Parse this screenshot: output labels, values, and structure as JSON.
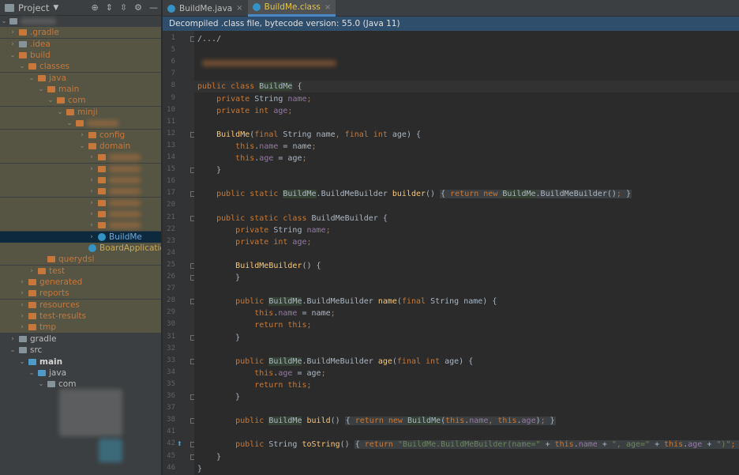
{
  "project_panel": {
    "title": "Project",
    "dropdown_icon": "triangle-down-icon",
    "toolbar_icons": [
      "crosshair-icon",
      "expand-all-icon",
      "collapse-all-icon",
      "gear-icon",
      "minimize-icon"
    ],
    "tree": [
      {
        "label": ".gradle",
        "depth": 1,
        "expanded": false,
        "icon": "folder-orange",
        "color": "orange",
        "hl": true
      },
      {
        "label": ".idea",
        "depth": 1,
        "expanded": false,
        "icon": "folder-gray",
        "color": "orange",
        "hl": true
      },
      {
        "label": "build",
        "depth": 1,
        "expanded": true,
        "icon": "folder-orange",
        "color": "orange",
        "hl": true
      },
      {
        "label": "classes",
        "depth": 2,
        "expanded": true,
        "icon": "folder-orange",
        "color": "orange",
        "hl": true
      },
      {
        "label": "java",
        "depth": 3,
        "expanded": true,
        "icon": "folder-orange",
        "color": "orange",
        "hl": true
      },
      {
        "label": "main",
        "depth": 4,
        "expanded": true,
        "icon": "folder-orange",
        "color": "orange",
        "hl": true
      },
      {
        "label": "com",
        "depth": 5,
        "expanded": true,
        "icon": "folder-orange",
        "color": "orange",
        "hl": true
      },
      {
        "label": "minji",
        "depth": 6,
        "expanded": true,
        "icon": "folder-orange",
        "color": "orange",
        "hl": true
      },
      {
        "label": "",
        "depth": 7,
        "expanded": true,
        "icon": "folder-orange",
        "color": "orange",
        "hl": true,
        "blurred": true
      },
      {
        "label": "config",
        "depth": 8,
        "expanded": false,
        "icon": "folder-orange",
        "color": "orange",
        "hl": true
      },
      {
        "label": "domain",
        "depth": 8,
        "expanded": true,
        "icon": "folder-orange",
        "color": "orange",
        "hl": true
      },
      {
        "label": "",
        "depth": 9,
        "expanded": false,
        "icon": "folder-orange",
        "color": "orange",
        "hl": true,
        "blurred": true
      },
      {
        "label": "",
        "depth": 9,
        "expanded": false,
        "icon": "folder-orange",
        "color": "orange",
        "hl": true,
        "blurred": true
      },
      {
        "label": "",
        "depth": 9,
        "expanded": false,
        "icon": "folder-orange",
        "color": "orange",
        "hl": true,
        "blurred": true
      },
      {
        "label": "",
        "depth": 9,
        "expanded": false,
        "icon": "folder-orange",
        "color": "orange",
        "hl": true,
        "blurred": true
      },
      {
        "label": "",
        "depth": 9,
        "expanded": false,
        "icon": "folder-orange",
        "color": "orange",
        "hl": true,
        "blurred": true
      },
      {
        "label": "",
        "depth": 9,
        "expanded": false,
        "icon": "folder-orange",
        "color": "orange",
        "hl": true,
        "blurred": true
      },
      {
        "label": "",
        "depth": 9,
        "expanded": false,
        "icon": "folder-orange",
        "color": "orange",
        "hl": true,
        "blurred": true
      },
      {
        "label": "BuildMe",
        "depth": 9,
        "expanded": false,
        "icon": "class-file",
        "color": "blue",
        "sel": true
      },
      {
        "label": "BoardApplication",
        "depth": 8,
        "leaf": true,
        "icon": "class-file",
        "color": "yellow",
        "hl": true
      },
      {
        "label": "querydsl",
        "depth": 4,
        "leaf": true,
        "icon": "folder-orange",
        "color": "orange",
        "hl": true
      },
      {
        "label": "test",
        "depth": 3,
        "expanded": false,
        "icon": "folder-orange",
        "color": "orange",
        "hl": true
      },
      {
        "label": "generated",
        "depth": 2,
        "expanded": false,
        "icon": "folder-orange",
        "color": "orange",
        "hl": true
      },
      {
        "label": "reports",
        "depth": 2,
        "expanded": false,
        "icon": "folder-orange",
        "color": "orange",
        "hl": true
      },
      {
        "label": "resources",
        "depth": 2,
        "expanded": false,
        "icon": "folder-orange",
        "color": "orange",
        "hl": true
      },
      {
        "label": "test-results",
        "depth": 2,
        "expanded": false,
        "icon": "folder-orange",
        "color": "orange",
        "hl": true
      },
      {
        "label": "tmp",
        "depth": 2,
        "expanded": false,
        "icon": "folder-orange",
        "color": "orange",
        "hl": true
      },
      {
        "label": "gradle",
        "depth": 1,
        "expanded": false,
        "icon": "folder-gray",
        "color": "white"
      },
      {
        "label": "src",
        "depth": 1,
        "expanded": true,
        "icon": "folder-gray",
        "color": "white"
      },
      {
        "label": "main",
        "depth": 2,
        "expanded": true,
        "icon": "folder-blue",
        "color": "bold"
      },
      {
        "label": "java",
        "depth": 3,
        "expanded": true,
        "icon": "folder-blue",
        "color": "white"
      },
      {
        "label": "com",
        "depth": 4,
        "expanded": true,
        "icon": "folder-gray",
        "color": "white"
      }
    ]
  },
  "editor": {
    "tabs": [
      {
        "label": "BuildMe.java",
        "active": false
      },
      {
        "label": "BuildMe.class",
        "active": true
      }
    ],
    "banner": "Decompiled .class file, bytecode version: 55.0 (Java 11)",
    "lines": [
      {
        "n": "1",
        "html": "/.../",
        "fold": true
      },
      {
        "n": "5",
        "html": ""
      },
      {
        "n": "6",
        "html": "",
        "blurred": true
      },
      {
        "n": "7",
        "html": ""
      },
      {
        "n": "8",
        "html": "<span class=\"kw\">public class </span><span class=\"hlid\">BuildMe</span> {",
        "current": true
      },
      {
        "n": "9",
        "html": "    <span class=\"kw\">private </span>String <span class=\"fld\">name</span><span class=\"kw\">;</span>"
      },
      {
        "n": "10",
        "html": "    <span class=\"kw\">private int </span><span class=\"fld\">age</span><span class=\"kw\">;</span>"
      },
      {
        "n": "11",
        "html": ""
      },
      {
        "n": "12",
        "html": "    <span class=\"fn\">BuildMe</span>(<span class=\"kw\">final </span>String name<span class=\"kw\">, final int </span>age) {",
        "fold": true
      },
      {
        "n": "13",
        "html": "        <span class=\"kw\">this</span>.<span class=\"fld\">name</span> = name<span class=\"kw\">;</span>"
      },
      {
        "n": "14",
        "html": "        <span class=\"kw\">this</span>.<span class=\"fld\">age</span> = age<span class=\"kw\">;</span>"
      },
      {
        "n": "15",
        "html": "    }",
        "fold": true
      },
      {
        "n": "16",
        "html": ""
      },
      {
        "n": "17",
        "html": "    <span class=\"kw\">public static </span><span class=\"hlid\">BuildMe</span>.BuildMeBuilder <span class=\"fn\">builder</span>() <span class=\"fold\">{ <span class=\"kw\">return new </span><span class=\"hlid\">BuildMe</span>.BuildMeBuilder()<span class=\"kw\">;</span> }</span>",
        "fold": true
      },
      {
        "n": "20",
        "html": ""
      },
      {
        "n": "21",
        "html": "    <span class=\"kw\">public static class </span>BuildMeBuilder {",
        "fold": true
      },
      {
        "n": "22",
        "html": "        <span class=\"kw\">private </span>String <span class=\"fld\">name</span><span class=\"kw\">;</span>"
      },
      {
        "n": "23",
        "html": "        <span class=\"kw\">private int </span><span class=\"fld\">age</span><span class=\"kw\">;</span>"
      },
      {
        "n": "24",
        "html": ""
      },
      {
        "n": "25",
        "html": "        <span class=\"fn\">BuildMeBuilder</span>() {",
        "fold": true
      },
      {
        "n": "26",
        "html": "        }",
        "fold": true
      },
      {
        "n": "27",
        "html": ""
      },
      {
        "n": "28",
        "html": "        <span class=\"kw\">public </span><span class=\"hlid\">BuildMe</span>.BuildMeBuilder <span class=\"fn\">name</span>(<span class=\"kw\">final </span>String name) {",
        "fold": true
      },
      {
        "n": "29",
        "html": "            <span class=\"kw\">this</span>.<span class=\"fld\">name</span> = name<span class=\"kw\">;</span>"
      },
      {
        "n": "30",
        "html": "            <span class=\"kw\">return this;</span>"
      },
      {
        "n": "31",
        "html": "        }",
        "fold": true
      },
      {
        "n": "32",
        "html": ""
      },
      {
        "n": "33",
        "html": "        <span class=\"kw\">public </span><span class=\"hlid\">BuildMe</span>.BuildMeBuilder <span class=\"fn\">age</span>(<span class=\"kw\">final int </span>age) {",
        "fold": true
      },
      {
        "n": "34",
        "html": "            <span class=\"kw\">this</span>.<span class=\"fld\">age</span> = age<span class=\"kw\">;</span>"
      },
      {
        "n": "35",
        "html": "            <span class=\"kw\">return this;</span>"
      },
      {
        "n": "36",
        "html": "        }",
        "fold": true
      },
      {
        "n": "37",
        "html": ""
      },
      {
        "n": "38",
        "html": "        <span class=\"kw\">public </span><span class=\"hlid\">BuildMe</span> <span class=\"fn\">build</span>() <span class=\"fold\">{ <span class=\"kw\">return new </span><span class=\"hlid\">BuildMe</span>(<span class=\"kw\">this</span>.<span class=\"fld\">name</span><span class=\"kw\">, this</span>.<span class=\"fld\">age</span>)<span class=\"kw\">;</span> }</span>",
        "fold": true
      },
      {
        "n": "41",
        "html": ""
      },
      {
        "n": "42",
        "html": "        <span class=\"kw\">public </span>String <span class=\"fn\">toString</span>() <span class=\"fold\">{ <span class=\"kw\">return </span><span class=\"str\">\"BuildMe.BuildMeBuilder(name=\"</span> + <span class=\"kw\">this</span>.<span class=\"fld\">name</span> + <span class=\"str\">\", age=\"</span> + <span class=\"kw\">this</span>.<span class=\"fld\">age</span> + <span class=\"str\">\")\"</span><span class=\"kw\">;</span> }</span>",
        "fold": true,
        "override": true
      },
      {
        "n": "45",
        "html": "    }",
        "fold": true
      },
      {
        "n": "46",
        "html": "}"
      }
    ]
  },
  "colors": {
    "panel_bg": "#3c3f41",
    "editor_bg": "#2b2b2b",
    "banner_bg": "#2f4e6b",
    "keyword": "#cc7832",
    "field": "#9876aa",
    "method": "#ffc66d",
    "string": "#6a8759",
    "active_tab_text": "#e7c547"
  }
}
